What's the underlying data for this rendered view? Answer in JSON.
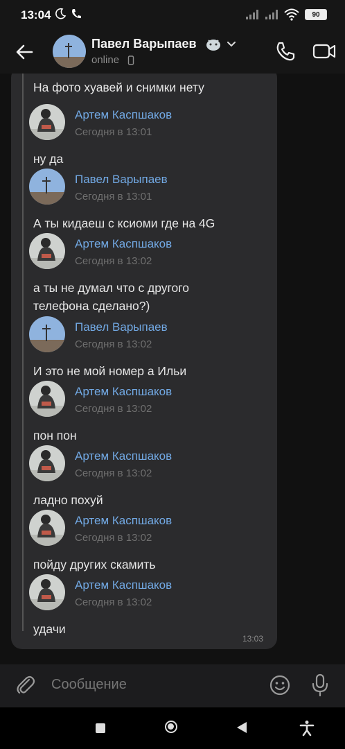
{
  "status_bar": {
    "time": "13:04",
    "battery": "90",
    "icons": [
      "moon-icon",
      "phone-icon",
      "signal-icon",
      "signal-icon",
      "wifi-icon",
      "battery-icon"
    ]
  },
  "header": {
    "name": "Павел Варыпаев",
    "status": "online",
    "icons": [
      "back-arrow-icon",
      "chevron-down-icon",
      "phone-call-icon",
      "video-call-icon"
    ]
  },
  "conversation": {
    "first_text": "На фото хуавей и снимки нету",
    "messages": [
      {
        "author": "Артем Каспшаков",
        "time": "Сегодня в 13:01",
        "text": "ну да",
        "avatar": "artem"
      },
      {
        "author": "Павел Варыпаев",
        "time": "Сегодня в 13:01",
        "text": "А ты кидаеш с ксиоми где на 4G",
        "avatar": "pavel"
      },
      {
        "author": "Артем Каспшаков",
        "time": "Сегодня в 13:02",
        "text": "а ты не думал что с другого телефона сделано?)",
        "avatar": "artem"
      },
      {
        "author": "Павел Варыпаев",
        "time": "Сегодня в 13:02",
        "text": "И это не мой номер а Ильи",
        "avatar": "pavel"
      },
      {
        "author": "Артем Каспшаков",
        "time": "Сегодня в 13:02",
        "text": "пон пон",
        "avatar": "artem"
      },
      {
        "author": "Артем Каспшаков",
        "time": "Сегодня в 13:02",
        "text": "ладно похуй",
        "avatar": "artem"
      },
      {
        "author": "Артем Каспшаков",
        "time": "Сегодня в 13:02",
        "text": "пойду других скамить",
        "avatar": "artem"
      },
      {
        "author": "Артем Каспшаков",
        "time": "Сегодня в 13:02",
        "text": "удачи",
        "avatar": "artem"
      }
    ],
    "bubble_time": "13:03"
  },
  "composer": {
    "placeholder": "Сообщение"
  },
  "colors": {
    "accent_name": "#72a9e4",
    "bubble": "#2b2b2d",
    "background": "#111111"
  }
}
